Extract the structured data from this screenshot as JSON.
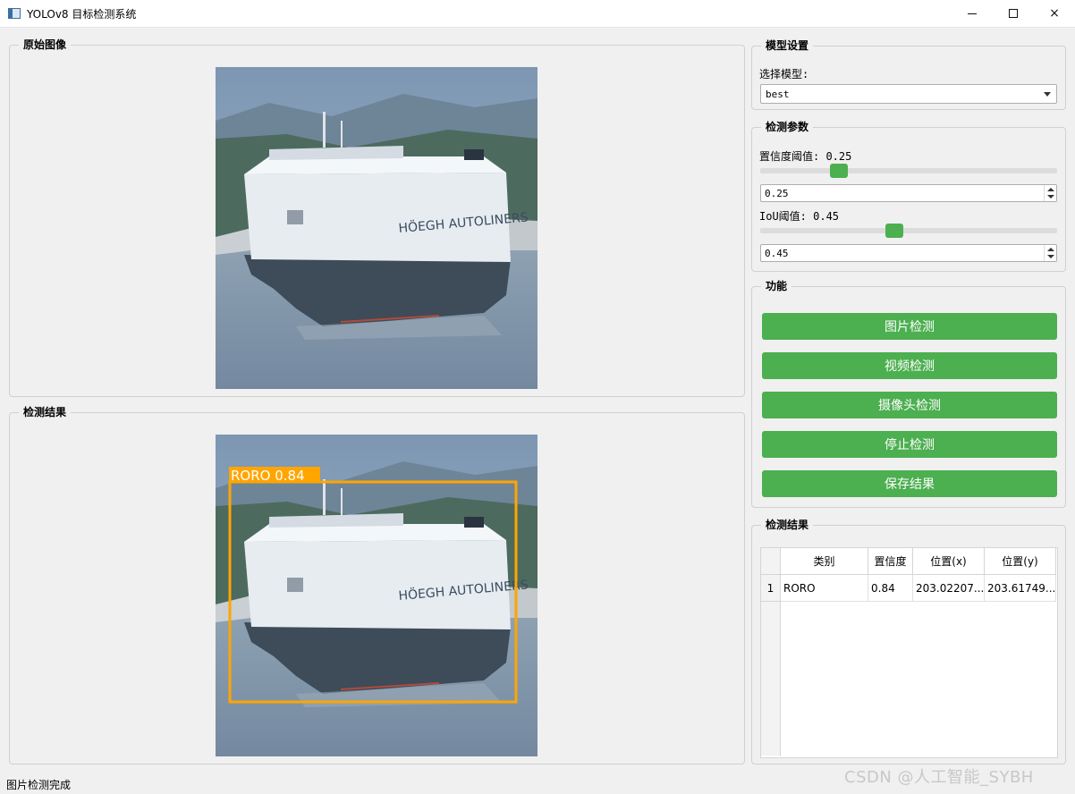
{
  "window": {
    "title": "YOLOv8 目标检测系统",
    "minimize_glyph": "minimize-icon",
    "maximize_glyph": "maximize-icon",
    "close_glyph": "×"
  },
  "original_panel": {
    "title": "原始图像"
  },
  "result_panel": {
    "title": "检测结果",
    "detection_label": "RORO 0.84",
    "box_color": "#ffa500"
  },
  "model_settings": {
    "title": "模型设置",
    "select_label": "选择模型:",
    "selected_model": "best"
  },
  "params": {
    "title": "检测参数",
    "confidence_label": "置信度阈值: 0.25",
    "confidence_value": "0.25",
    "confidence_level": 0.25,
    "iou_label": "IoU阈值: 0.45",
    "iou_value": "0.45",
    "iou_level": 0.45
  },
  "functions": {
    "title": "功能",
    "buttons": [
      "图片检测",
      "视频检测",
      "摄像头检测",
      "停止检测",
      "保存结果"
    ],
    "button_color": "#4caf50"
  },
  "results_table": {
    "title": "检测结果",
    "headers": [
      "类别",
      "置信度",
      "位置(x)",
      "位置(y)"
    ],
    "rows": [
      {
        "index": "1",
        "cells": [
          "RORO",
          "0.84",
          "203.02207...",
          "203.61749..."
        ]
      }
    ]
  },
  "status": {
    "text": "图片检测完成"
  },
  "watermark": "CSDN @人工智能_SYBH"
}
